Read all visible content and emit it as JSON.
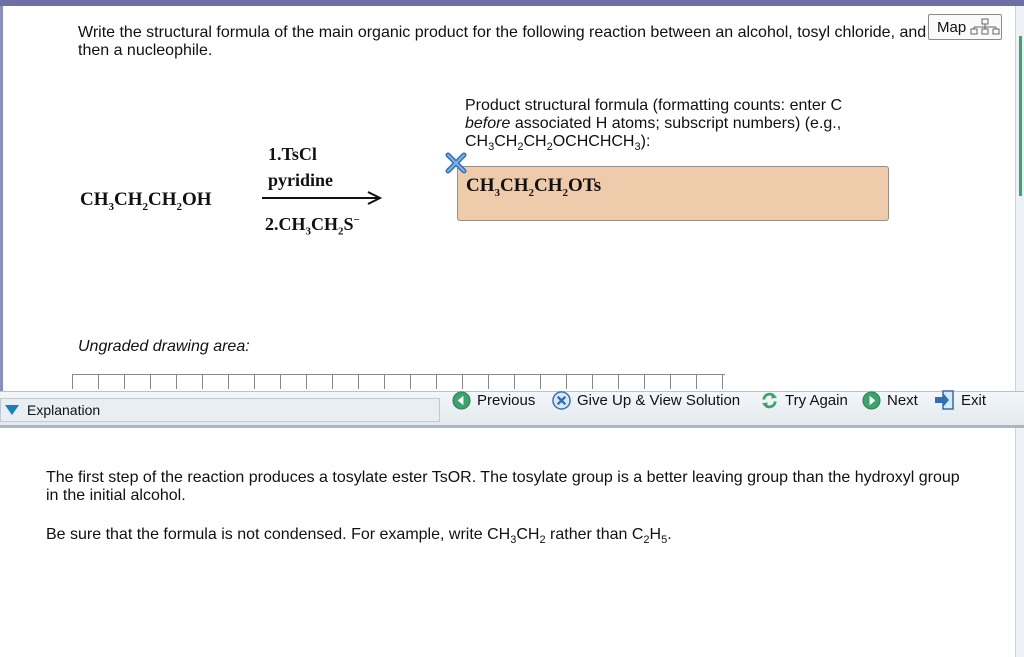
{
  "question": {
    "text": "Write the structural formula of the main organic product for the following reaction between an alcohol, tosyl chloride, and then a nucleophile."
  },
  "map_button": {
    "label": "Map"
  },
  "reaction": {
    "reactant": {
      "a": "CH",
      "s1": "3",
      "b": "CH",
      "s2": "2",
      "c": "CH",
      "s3": "2",
      "d": "OH"
    },
    "step1_line1": "1.TsCl",
    "step1_line2": "pyridine",
    "step2": {
      "a": "2.CH",
      "s1": "3",
      "b": "CH",
      "s2": "2",
      "c": "S",
      "charge": "−"
    }
  },
  "product": {
    "label_part1": "Product structural formula (formatting counts: enter C ",
    "label_italic": "before",
    "label_part2": " associated H atoms; subscript numbers) (e.g., ",
    "example": {
      "a": "CH",
      "s1": "3",
      "b": "CH",
      "s2": "2",
      "c": "CH",
      "s3": "2",
      "d": "OCHCHCH",
      "s4": "3"
    },
    "label_end": "):",
    "answer": {
      "a": "CH",
      "s1": "3",
      "b": "CH",
      "s2": "2",
      "c": "CH",
      "s3": "2",
      "d": "OTs"
    },
    "status": "incorrect"
  },
  "drawing_area": {
    "label": "Ungraded drawing area:"
  },
  "toolbar": {
    "explanation_label": "Explanation",
    "previous_label": "Previous",
    "giveup_label": "Give Up & View Solution",
    "tryagain_label": "Try Again",
    "next_label": "Next",
    "exit_label": "Exit"
  },
  "explanation": {
    "p1": "The first step of the reaction produces a tosylate ester TsOR. The tosylate group is a better leaving group than the hydroxyl group in the initial alcohol.",
    "p2_a": "Be sure that the formula is not condensed. For example, write CH",
    "p2_s1": "3",
    "p2_b": "CH",
    "p2_s2": "2",
    "p2_c": " rather than C",
    "p2_s3": "2",
    "p2_d": "H",
    "p2_s4": "5",
    "p2_e": "."
  },
  "colors": {
    "accent": "#6c6fa8",
    "answer_bg": "#eecbaa",
    "wrong_mark": "#2f6fb5",
    "nav_icon": "#3aa56a"
  }
}
